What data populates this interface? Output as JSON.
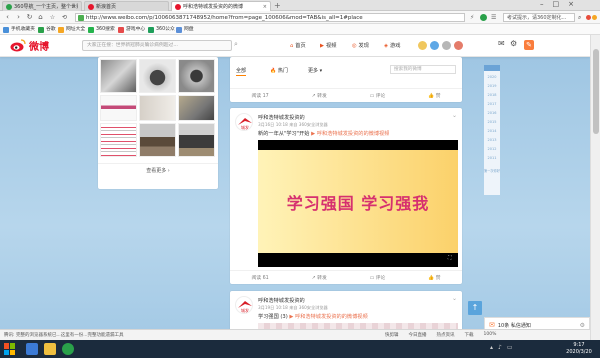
{
  "browser": {
    "tabs": [
      {
        "label": "360导航_一个主页，整个世界",
        "active": false
      },
      {
        "label": "新浪首页",
        "active": false
      },
      {
        "label": "呼和浩特城发投资的的微博",
        "active": true
      }
    ],
    "url": "http://www.weibo.com/p/1006063871748952/home?from=page_100606&mod=TAB&is_all=1#place",
    "search_placeholder": "考试提示，请360定制化..."
  },
  "bookmarks": [
    {
      "label": "手机收藏夹",
      "color": "#4a90d9"
    },
    {
      "label": "谷歌",
      "color": "#2aa14a"
    },
    {
      "label": "网址大全",
      "color": "#f5a623"
    },
    {
      "label": "360搜索",
      "color": "#24b34c"
    },
    {
      "label": "游戏中心",
      "color": "#e64a4a"
    },
    {
      "label": "360公众",
      "color": "#1e9e5a"
    },
    {
      "label": "网盘",
      "color": "#5b8fd8"
    }
  ],
  "weibo": {
    "logo": "微博",
    "search_placeholder": "大家正在搜：世界新冠肺炎确诊病例超过...",
    "nav": [
      {
        "label": "首页",
        "icon": "home-icon"
      },
      {
        "label": "视频",
        "icon": "video-icon"
      },
      {
        "label": "发现",
        "icon": "discover-icon"
      },
      {
        "label": "游戏",
        "icon": "game-icon"
      }
    ],
    "photo_more": "查看更多",
    "filter": {
      "all": "全部",
      "hot": "热门",
      "more": "更多",
      "search_placeholder": "搜索我的微博"
    },
    "action_top": {
      "views": "阅读 17",
      "repost": "转发",
      "comment": "评论",
      "like": "赞"
    },
    "posts": [
      {
        "author": "呼和浩特城发投资的",
        "meta": "3月16日 10:18 来自 360安全浏览器",
        "text": "新的一年从\"学习\"开始",
        "link": "呼和浩特城发投资的的微博视频",
        "video_title": "学习强国 学习强我",
        "actions": {
          "views": "阅读 61",
          "repost": "转发",
          "comment": "评论",
          "like": "赞"
        }
      },
      {
        "author": "呼和浩特城发投资的",
        "meta": "3月19日 10:18 来自 360安全浏览器",
        "text": "学习强国 (3)",
        "link": "呼和浩特城发投资的的微博视频"
      }
    ],
    "timeline_label": "第一次你好",
    "years": [
      "2020",
      "2019",
      "2018",
      "2017",
      "2016",
      "2015",
      "2014",
      "2013",
      "2012",
      "2011"
    ],
    "chat_label": "10条 私信通知"
  },
  "status": {
    "left": "腾讯: 完整的浏览器系统已...这里有一份...完整功能遗漏工具",
    "items": [
      "快剪辑",
      "今日直播",
      "热点资讯",
      "下载",
      "100%"
    ]
  },
  "taskbar": {
    "time": "9:17",
    "date": "2020/3/20"
  }
}
